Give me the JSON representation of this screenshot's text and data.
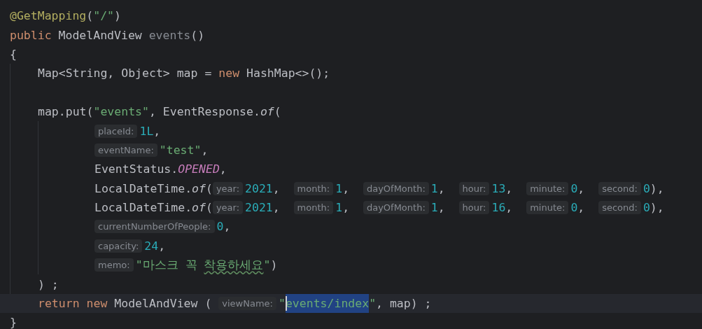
{
  "editor": {
    "lines": [
      {
        "kind": "code",
        "tokens": [
          {
            "kind": "annotation",
            "text": "@GetMapping"
          },
          {
            "kind": "plain",
            "text": "("
          },
          {
            "kind": "string",
            "text": "\"/\""
          },
          {
            "kind": "plain",
            "text": ")"
          }
        ]
      },
      {
        "kind": "code",
        "tokens": [
          {
            "kind": "keyword",
            "text": "public"
          },
          {
            "kind": "plain",
            "text": " ModelAndView "
          },
          {
            "kind": "unused",
            "text": "events"
          },
          {
            "kind": "plain",
            "text": "()"
          }
        ]
      },
      {
        "kind": "code",
        "tokens": [
          {
            "kind": "plain",
            "text": "{"
          }
        ],
        "children": [
          {
            "kind": "code",
            "tokens": [
              {
                "kind": "plain",
                "text": "Map<String, Object> map = "
              },
              {
                "kind": "keyword",
                "text": "new"
              },
              {
                "kind": "plain",
                "text": " HashMap<>();"
              }
            ]
          },
          {
            "kind": "blank"
          },
          {
            "kind": "code",
            "tokens": [
              {
                "kind": "plain",
                "text": "map.put("
              },
              {
                "kind": "string",
                "text": "\"events\""
              },
              {
                "kind": "plain",
                "text": ", EventResponse."
              },
              {
                "kind": "italic",
                "text": "of"
              },
              {
                "kind": "plain",
                "text": "("
              }
            ],
            "children": [
              {
                "kind": "code",
                "tokens": [
                  {
                    "kind": "hint",
                    "text": "placeId:"
                  },
                  {
                    "kind": "number",
                    "text": "1L"
                  },
                  {
                    "kind": "plain",
                    "text": ","
                  }
                ]
              },
              {
                "kind": "code",
                "tokens": [
                  {
                    "kind": "hint",
                    "text": "eventName:"
                  },
                  {
                    "kind": "string",
                    "text": "\"test\""
                  },
                  {
                    "kind": "plain",
                    "text": ","
                  }
                ]
              },
              {
                "kind": "code",
                "tokens": [
                  {
                    "kind": "plain",
                    "text": "EventStatus."
                  },
                  {
                    "kind": "constant",
                    "text": "OPENED"
                  },
                  {
                    "kind": "plain",
                    "text": ","
                  }
                ]
              },
              {
                "kind": "code",
                "tokens": [
                  {
                    "kind": "plain",
                    "text": "LocalDateTime."
                  },
                  {
                    "kind": "italic",
                    "text": "of"
                  },
                  {
                    "kind": "plain",
                    "text": "("
                  },
                  {
                    "kind": "hint",
                    "text": "year:"
                  },
                  {
                    "kind": "number",
                    "text": "2021"
                  },
                  {
                    "kind": "plain",
                    "text": ",  "
                  },
                  {
                    "kind": "hint",
                    "text": "month:"
                  },
                  {
                    "kind": "number",
                    "text": "1"
                  },
                  {
                    "kind": "plain",
                    "text": ",  "
                  },
                  {
                    "kind": "hint",
                    "text": "dayOfMonth:"
                  },
                  {
                    "kind": "number",
                    "text": "1"
                  },
                  {
                    "kind": "plain",
                    "text": ",  "
                  },
                  {
                    "kind": "hint",
                    "text": "hour:"
                  },
                  {
                    "kind": "number",
                    "text": "13"
                  },
                  {
                    "kind": "plain",
                    "text": ",  "
                  },
                  {
                    "kind": "hint",
                    "text": "minute:"
                  },
                  {
                    "kind": "number",
                    "text": "0"
                  },
                  {
                    "kind": "plain",
                    "text": ",  "
                  },
                  {
                    "kind": "hint",
                    "text": "second:"
                  },
                  {
                    "kind": "number",
                    "text": "0"
                  },
                  {
                    "kind": "plain",
                    "text": "),"
                  }
                ]
              },
              {
                "kind": "code",
                "tokens": [
                  {
                    "kind": "plain",
                    "text": "LocalDateTime."
                  },
                  {
                    "kind": "italic",
                    "text": "of"
                  },
                  {
                    "kind": "plain",
                    "text": "("
                  },
                  {
                    "kind": "hint",
                    "text": "year:"
                  },
                  {
                    "kind": "number",
                    "text": "2021"
                  },
                  {
                    "kind": "plain",
                    "text": ",  "
                  },
                  {
                    "kind": "hint",
                    "text": "month:"
                  },
                  {
                    "kind": "number",
                    "text": "1"
                  },
                  {
                    "kind": "plain",
                    "text": ",  "
                  },
                  {
                    "kind": "hint",
                    "text": "dayOfMonth:"
                  },
                  {
                    "kind": "number",
                    "text": "1"
                  },
                  {
                    "kind": "plain",
                    "text": ",  "
                  },
                  {
                    "kind": "hint",
                    "text": "hour:"
                  },
                  {
                    "kind": "number",
                    "text": "16"
                  },
                  {
                    "kind": "plain",
                    "text": ",  "
                  },
                  {
                    "kind": "hint",
                    "text": "minute:"
                  },
                  {
                    "kind": "number",
                    "text": "0"
                  },
                  {
                    "kind": "plain",
                    "text": ",  "
                  },
                  {
                    "kind": "hint",
                    "text": "second:"
                  },
                  {
                    "kind": "number",
                    "text": "0"
                  },
                  {
                    "kind": "plain",
                    "text": "),"
                  }
                ]
              },
              {
                "kind": "code",
                "tokens": [
                  {
                    "kind": "hint",
                    "text": "currentNumberOfPeople:"
                  },
                  {
                    "kind": "number",
                    "text": "0"
                  },
                  {
                    "kind": "plain",
                    "text": ","
                  }
                ]
              },
              {
                "kind": "code",
                "tokens": [
                  {
                    "kind": "hint",
                    "text": "capacity:"
                  },
                  {
                    "kind": "number",
                    "text": "24"
                  },
                  {
                    "kind": "plain",
                    "text": ","
                  }
                ]
              },
              {
                "kind": "code",
                "tokens": [
                  {
                    "kind": "hint",
                    "text": "memo:"
                  },
                  {
                    "kind": "string",
                    "text": "\"마스크 꼭 "
                  },
                  {
                    "kind": "typo",
                    "text": "착용하세요"
                  },
                  {
                    "kind": "string",
                    "text": "\""
                  },
                  {
                    "kind": "plain",
                    "text": ")"
                  }
                ]
              }
            ]
          },
          {
            "kind": "code",
            "tokens": [
              {
                "kind": "plain",
                "text": ") ;"
              }
            ]
          },
          {
            "kind": "current",
            "tokens": [
              {
                "kind": "keyword",
                "text": "return new"
              },
              {
                "kind": "plain",
                "text": " ModelAndView ( "
              },
              {
                "kind": "hint",
                "text": "viewName:"
              },
              {
                "kind": "string",
                "text": "\""
              },
              {
                "kind": "selection",
                "text": "events/index"
              },
              {
                "kind": "string",
                "text": "\""
              },
              {
                "kind": "plain",
                "text": ", map) ;"
              }
            ]
          }
        ]
      },
      {
        "kind": "code",
        "tokens": [
          {
            "kind": "plain",
            "text": "}"
          }
        ]
      }
    ]
  }
}
